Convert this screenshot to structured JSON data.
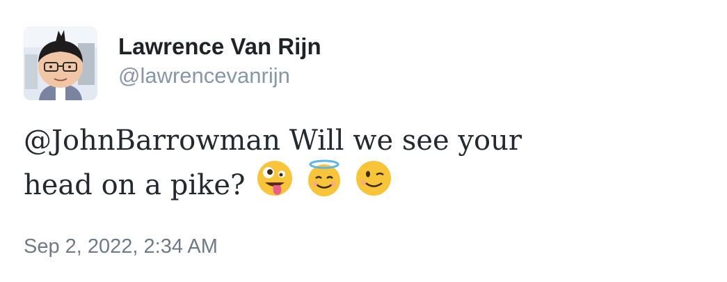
{
  "author": {
    "display_name": "Lawrence Van Rijn",
    "handle": "@lawrencevanrijn"
  },
  "tweet": {
    "text_line1": "@JohnBarrowman Will we see your",
    "text_line2": "head on a pike?",
    "emojis": [
      "zany-face-icon",
      "smiling-face-with-halo-icon",
      "winking-face-icon"
    ]
  },
  "meta": {
    "timestamp": "Sep 2, 2022, 2:34 AM"
  },
  "colors": {
    "name": "#1f2328",
    "handle": "#8796a8",
    "body_text": "#24292f",
    "timestamp": "#6f7a86",
    "emoji_yellow": "#f7c43a"
  }
}
